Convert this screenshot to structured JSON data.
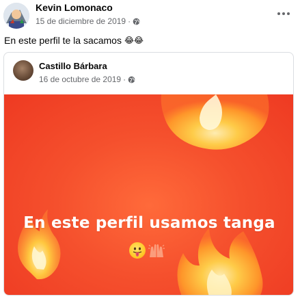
{
  "post": {
    "author": "Kevin Lomonaco",
    "date": "15 de diciembre de 2019",
    "separator": "·",
    "caption": "En este perfil te la sacamos",
    "caption_emojis": "😂😂"
  },
  "shared": {
    "author": "Castillo Bárbara",
    "date": "16 de octubre de 2019",
    "separator": "·",
    "banner_text": "En este perfil usamos tanga",
    "banner_emojis": "😛🙌"
  },
  "icons": {
    "privacy": "globe-icon",
    "menu": "more-horizontal-icon",
    "banner_decor": "fire-icon"
  },
  "colors": {
    "banner_bg": "#f5502d",
    "name": "#050505",
    "meta": "#65676b",
    "border": "#dadde1"
  }
}
